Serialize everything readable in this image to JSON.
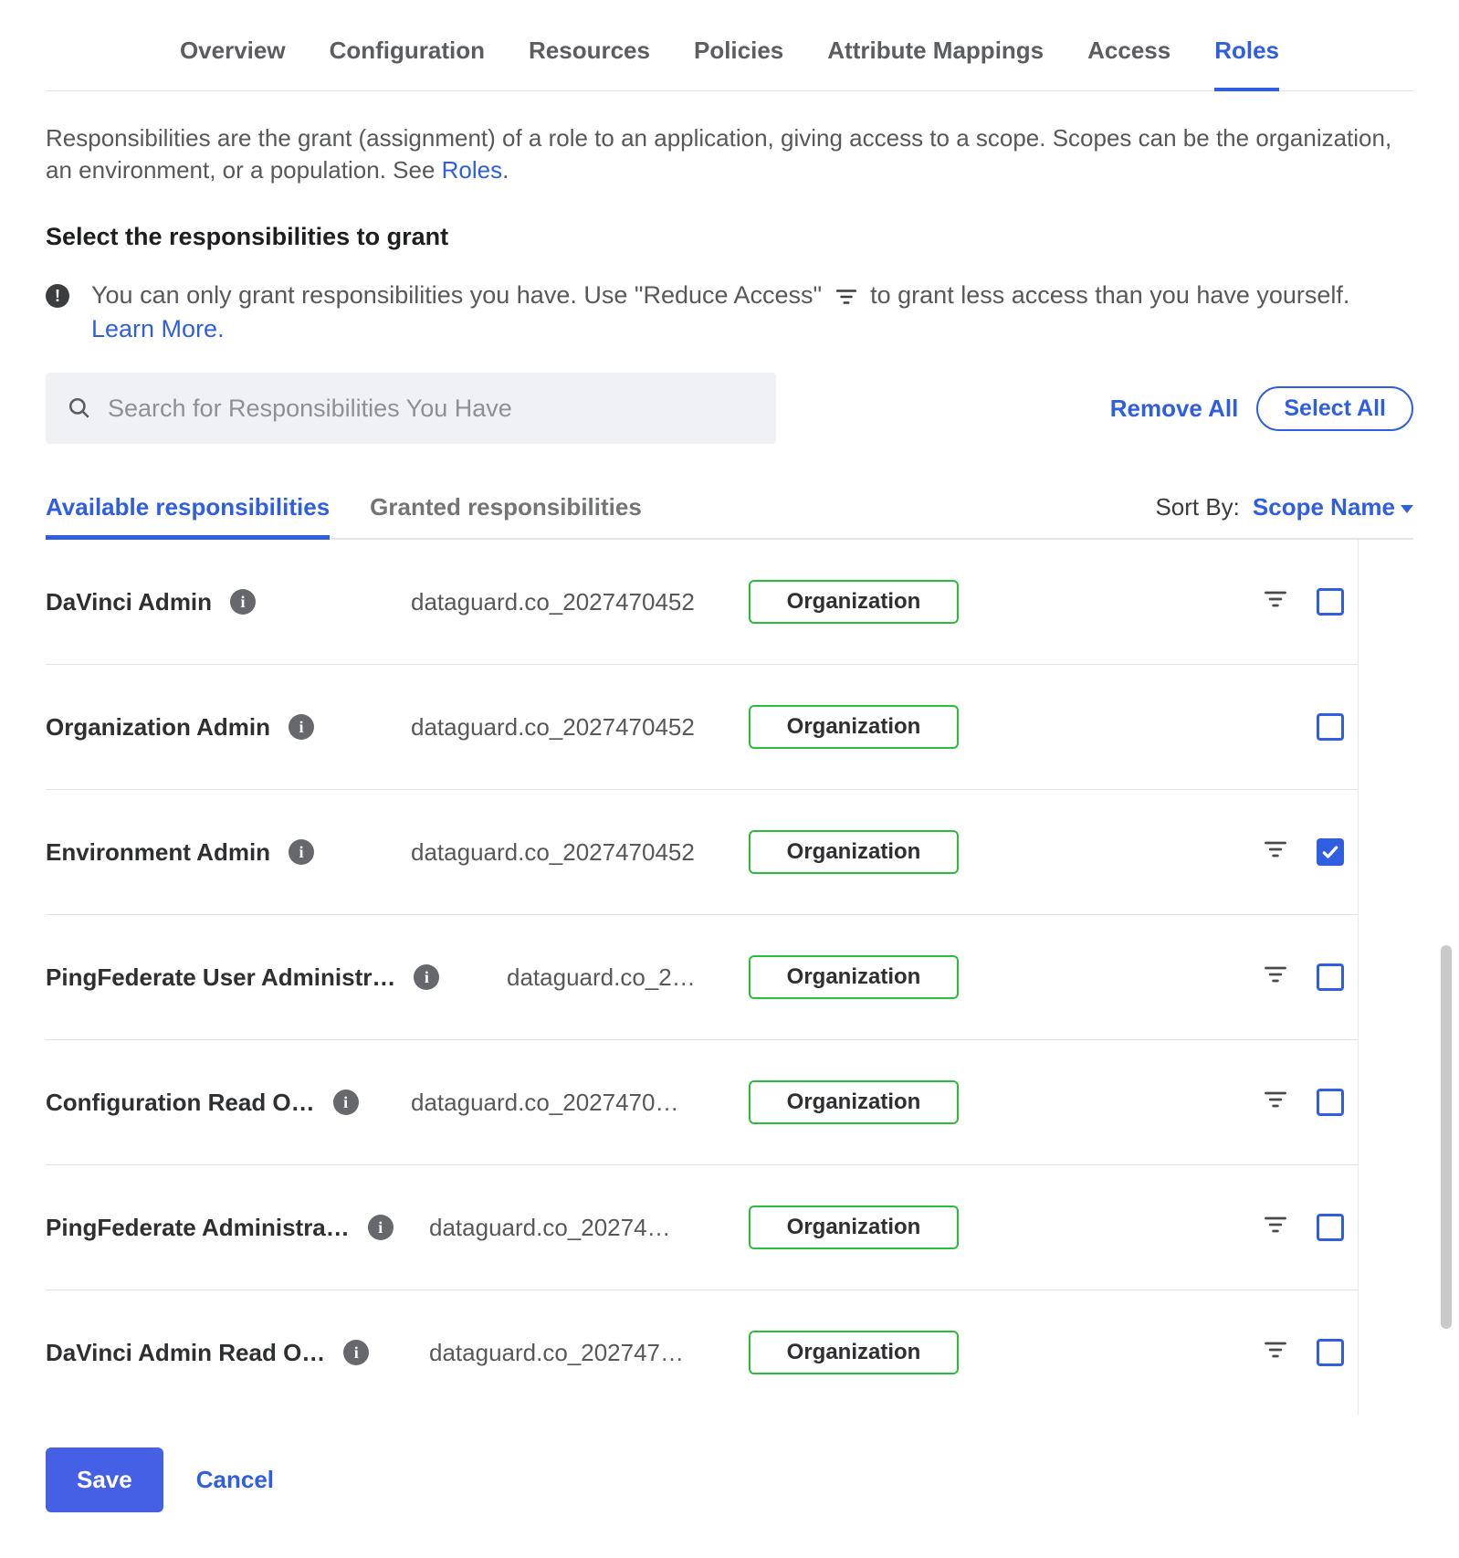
{
  "tabs": {
    "items": [
      "Overview",
      "Configuration",
      "Resources",
      "Policies",
      "Attribute Mappings",
      "Access",
      "Roles"
    ],
    "activeIndex": 6
  },
  "intro": {
    "text_before_link": "Responsibilities are the grant (assignment) of a role to an application, giving access to a scope. Scopes can be the organization, an environment, or a population. See ",
    "link_text": "Roles",
    "text_after_link": "."
  },
  "subhead": "Select the responsibilities to grant",
  "note": {
    "part1": "You can only grant responsibilities you have. Use \"Reduce Access\" ",
    "part2": " to grant less access than you have yourself. ",
    "learn_more": "Learn More."
  },
  "controls": {
    "search_placeholder": "Search for Responsibilities You Have",
    "remove_all": "Remove All",
    "select_all": "Select All"
  },
  "subtabs": {
    "available": "Available responsibilities",
    "granted": "Granted responsibilities",
    "activeIndex": 0
  },
  "sort": {
    "label": "Sort By:",
    "value": "Scope Name"
  },
  "rows": [
    {
      "name": "DaVinci Admin",
      "id": "dataguard.co_2027470452",
      "scope": "Organization",
      "hasFilter": true,
      "checked": false,
      "nameW": 400,
      "idW": 370
    },
    {
      "name": "Organization Admin",
      "id": "dataguard.co_2027470452",
      "scope": "Organization",
      "hasFilter": false,
      "checked": false,
      "nameW": 400,
      "idW": 370
    },
    {
      "name": "Environment Admin",
      "id": "dataguard.co_2027470452",
      "scope": "Organization",
      "hasFilter": true,
      "checked": true,
      "nameW": 400,
      "idW": 370
    },
    {
      "name": "PingFederate User Administr…",
      "id": "dataguard.co_2…",
      "scope": "Organization",
      "hasFilter": true,
      "checked": false,
      "nameW": 505,
      "idW": 265
    },
    {
      "name": "Configuration Read O…",
      "id": "dataguard.co_2027470…",
      "scope": "Organization",
      "hasFilter": true,
      "checked": false,
      "nameW": 400,
      "idW": 370
    },
    {
      "name": "PingFederate Administra…",
      "id": "dataguard.co_20274…",
      "scope": "Organization",
      "hasFilter": true,
      "checked": false,
      "nameW": 420,
      "idW": 350
    },
    {
      "name": "DaVinci Admin Read O…",
      "id": "dataguard.co_202747…",
      "scope": "Organization",
      "hasFilter": true,
      "checked": false,
      "nameW": 420,
      "idW": 350
    }
  ],
  "footer": {
    "save": "Save",
    "cancel": "Cancel"
  }
}
